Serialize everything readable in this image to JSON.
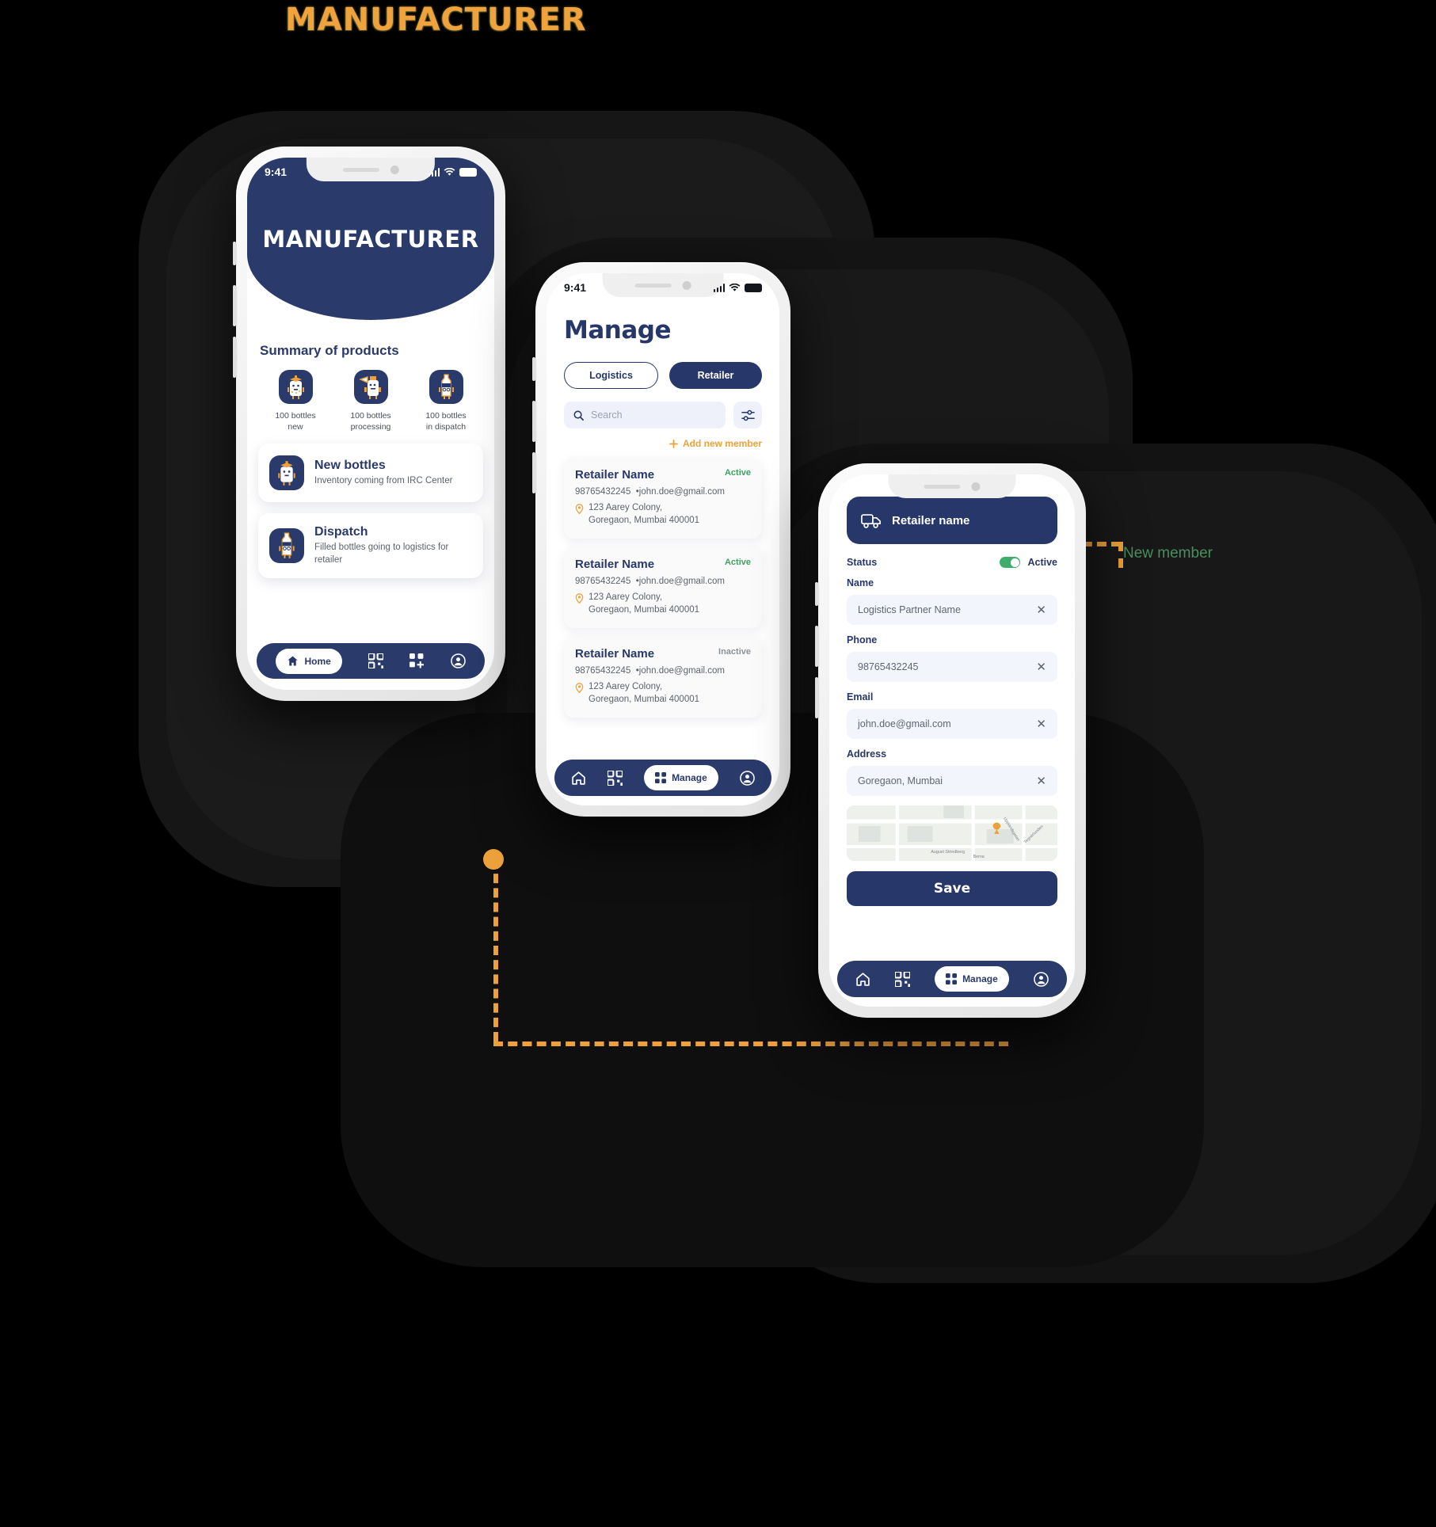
{
  "page": {
    "title": "MANUFACTURER",
    "title_color": "#eda13a"
  },
  "theme": {
    "navy": "#27376a",
    "orange": "#eda13a",
    "green": "#3f9e62",
    "field_bg": "#f2f5fc"
  },
  "connector": {
    "label": "New member"
  },
  "phone1": {
    "status": {
      "time": "9:41"
    },
    "hero_title": "MANUFACTURER",
    "section_title": "Summary of products",
    "stats": [
      {
        "icon": "bottle-graduate-icon",
        "line1": "100 bottles",
        "line2": "new"
      },
      {
        "icon": "bottle-processing-icon",
        "line1": "100 bottles",
        "line2": "processing"
      },
      {
        "icon": "bottle-dispatch-icon",
        "line1": "100 bottles",
        "line2": "in dispatch"
      }
    ],
    "cards": [
      {
        "icon": "bottle-graduate-icon",
        "title": "New bottles",
        "desc": "Inventory coming from IRC Center"
      },
      {
        "icon": "bottle-dispatch-icon",
        "title": "Dispatch",
        "desc": "Filled bottles going to logistics for retailer"
      }
    ],
    "nav": [
      {
        "icon": "home-icon",
        "label": "Home",
        "active": true
      },
      {
        "icon": "qr-code-icon",
        "label": "",
        "active": false
      },
      {
        "icon": "grid-plus-icon",
        "label": "",
        "active": false
      },
      {
        "icon": "profile-icon",
        "label": "",
        "active": false
      }
    ]
  },
  "phone2": {
    "status": {
      "time": "9:41"
    },
    "title": "Manage",
    "segments": [
      {
        "label": "Logistics",
        "selected": false
      },
      {
        "label": "Retailer",
        "selected": true
      }
    ],
    "search": {
      "placeholder": "Search",
      "value": ""
    },
    "filter_icon": "filter-sliders-icon",
    "add_member": "Add new member",
    "retailers": [
      {
        "name": "Retailer Name",
        "status": "Active",
        "phone": "98765432245",
        "email": "john.doe@gmail.com",
        "address_line1": "123 Aarey Colony,",
        "address_line2": "Goregaon, Mumbai 400001"
      },
      {
        "name": "Retailer Name",
        "status": "Active",
        "phone": "98765432245",
        "email": "john.doe@gmail.com",
        "address_line1": "123 Aarey Colony,",
        "address_line2": "Goregaon, Mumbai 400001"
      },
      {
        "name": "Retailer Name",
        "status": "Inactive",
        "phone": "98765432245",
        "email": "john.doe@gmail.com",
        "address_line1": "123 Aarey Colony,",
        "address_line2": "Goregaon, Mumbai 400001"
      }
    ],
    "nav": [
      {
        "icon": "home-icon",
        "label": "",
        "active": false
      },
      {
        "icon": "qr-code-icon",
        "label": "",
        "active": false
      },
      {
        "icon": "grid-icon",
        "label": "Manage",
        "active": true
      },
      {
        "icon": "profile-icon",
        "label": "",
        "active": false
      }
    ]
  },
  "phone3": {
    "header": {
      "icon": "truck-icon",
      "title": "Retailer name"
    },
    "status_label": "Status",
    "status_value": "Active",
    "fields": [
      {
        "label": "Name",
        "value": "Logistics Partner Name"
      },
      {
        "label": "Phone",
        "value": "98765432245"
      },
      {
        "label": "Email",
        "value": "john.doe@gmail.com"
      },
      {
        "label": "Address",
        "value": "Goregaon, Mumbai"
      }
    ],
    "map": {
      "labels": [
        "Upplandsgatan",
        "August Strindberg",
        "Berna",
        "Tegnérlunden"
      ]
    },
    "save_label": "Save",
    "nav": [
      {
        "icon": "home-icon",
        "label": "",
        "active": false
      },
      {
        "icon": "qr-code-icon",
        "label": "",
        "active": false
      },
      {
        "icon": "grid-icon",
        "label": "Manage",
        "active": true
      },
      {
        "icon": "profile-icon",
        "label": "",
        "active": false
      }
    ]
  }
}
